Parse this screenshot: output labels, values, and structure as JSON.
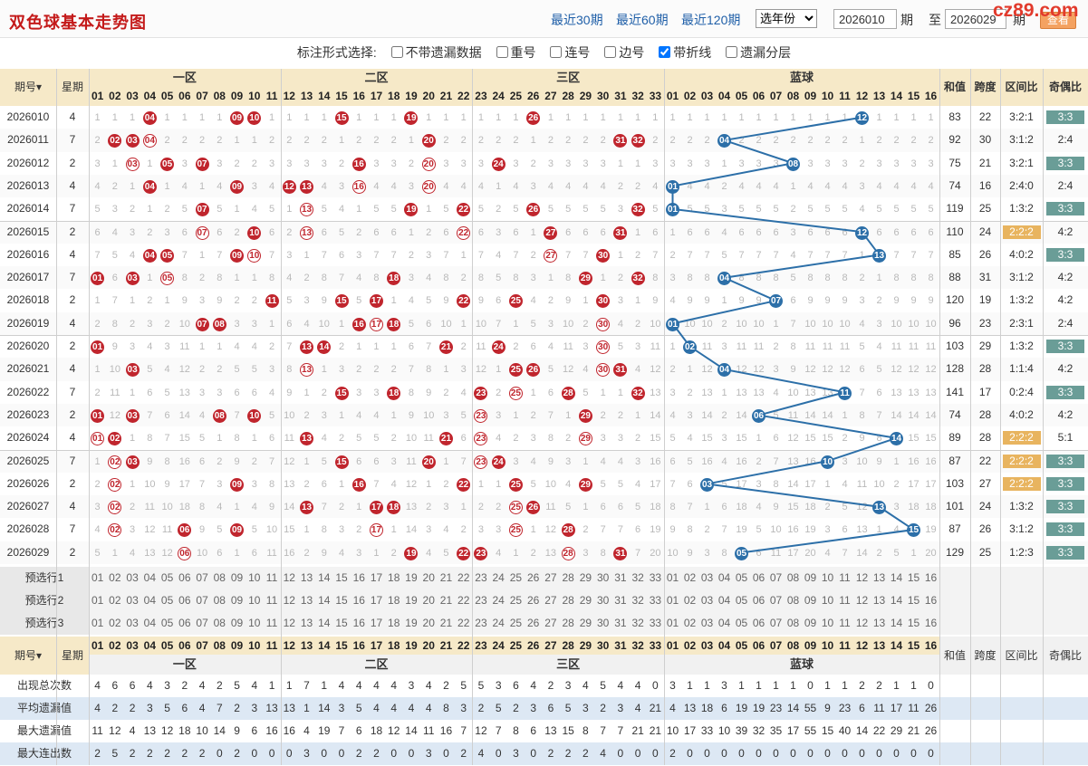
{
  "header": {
    "title": "双色球基本走势图",
    "links": [
      "最近30期",
      "最近60期",
      "最近120期"
    ],
    "year_select": "选年份",
    "from_issue": "2026010",
    "issue_label": "期",
    "to_label": "至",
    "to_issue": "2026029",
    "to_issue_suffix": "期",
    "query_button": "查看",
    "logo": "cz89.com"
  },
  "options": {
    "label": "标注形式选择:",
    "items": [
      {
        "label": "不带遗漏数据",
        "checked": false
      },
      {
        "label": "重号",
        "checked": false
      },
      {
        "label": "连号",
        "checked": false
      },
      {
        "label": "边号",
        "checked": false
      },
      {
        "label": "带折线",
        "checked": true
      },
      {
        "label": "遗漏分层",
        "checked": false
      }
    ]
  },
  "columns": {
    "issue": "期号",
    "weekday": "星期",
    "zones": [
      "一区",
      "二区",
      "三区",
      "蓝球"
    ],
    "sum": "和值",
    "span": "跨度",
    "zone_ratio": "区间比",
    "parity": "奇偶比"
  },
  "red_numbers": [
    "01",
    "02",
    "03",
    "04",
    "05",
    "06",
    "07",
    "08",
    "09",
    "10",
    "11",
    "12",
    "13",
    "14",
    "15",
    "16",
    "17",
    "18",
    "19",
    "20",
    "21",
    "22",
    "23",
    "24",
    "25",
    "26",
    "27",
    "28",
    "29",
    "30",
    "31",
    "32",
    "33"
  ],
  "blue_numbers": [
    "01",
    "02",
    "03",
    "04",
    "05",
    "06",
    "07",
    "08",
    "09",
    "10",
    "11",
    "12",
    "13",
    "14",
    "15",
    "16"
  ],
  "rows": [
    {
      "issue": "2026010",
      "weekday": "4",
      "reds": [
        4,
        9,
        10,
        15,
        19,
        26
      ],
      "blue": 12,
      "sum": "83",
      "span": "22",
      "zone": "3:2:1",
      "parity": "3:3"
    },
    {
      "issue": "2026011",
      "weekday": "7",
      "reds": [
        2,
        3,
        4,
        20,
        31,
        32
      ],
      "blue": 4,
      "sum": "92",
      "span": "30",
      "zone": "3:1:2",
      "parity": "2:4"
    },
    {
      "issue": "2026012",
      "weekday": "2",
      "reds": [
        3,
        5,
        7,
        16,
        20,
        24
      ],
      "blue": 8,
      "sum": "75",
      "span": "21",
      "zone": "3:2:1",
      "parity": "3:3"
    },
    {
      "issue": "2026013",
      "weekday": "4",
      "reds": [
        4,
        9,
        12,
        13,
        16,
        20
      ],
      "blue": 1,
      "sum": "74",
      "span": "16",
      "zone": "2:4:0",
      "parity": "2:4"
    },
    {
      "issue": "2026014",
      "weekday": "7",
      "reds": [
        7,
        13,
        19,
        22,
        26,
        32
      ],
      "blue": 1,
      "sum": "119",
      "span": "25",
      "zone": "1:3:2",
      "parity": "3:3"
    },
    {
      "issue": "2026015",
      "weekday": "2",
      "reds": [
        7,
        10,
        13,
        22,
        27,
        31
      ],
      "blue": 12,
      "sum": "110",
      "span": "24",
      "zone": "2:2:2",
      "parity": "4:2"
    },
    {
      "issue": "2026016",
      "weekday": "4",
      "reds": [
        4,
        5,
        9,
        10,
        27,
        30
      ],
      "blue": 13,
      "sum": "85",
      "span": "26",
      "zone": "4:0:2",
      "parity": "3:3"
    },
    {
      "issue": "2026017",
      "weekday": "7",
      "reds": [
        1,
        3,
        5,
        18,
        29,
        32
      ],
      "blue": 4,
      "sum": "88",
      "span": "31",
      "zone": "3:1:2",
      "parity": "4:2"
    },
    {
      "issue": "2026018",
      "weekday": "2",
      "reds": [
        11,
        15,
        17,
        22,
        25,
        30
      ],
      "blue": 7,
      "sum": "120",
      "span": "19",
      "zone": "1:3:2",
      "parity": "4:2"
    },
    {
      "issue": "2026019",
      "weekday": "4",
      "reds": [
        7,
        8,
        16,
        17,
        18,
        30
      ],
      "blue": 1,
      "sum": "96",
      "span": "23",
      "zone": "2:3:1",
      "parity": "2:4"
    },
    {
      "issue": "2026020",
      "weekday": "2",
      "reds": [
        1,
        13,
        14,
        21,
        24,
        30
      ],
      "blue": 2,
      "sum": "103",
      "span": "29",
      "zone": "1:3:2",
      "parity": "3:3"
    },
    {
      "issue": "2026021",
      "weekday": "4",
      "reds": [
        3,
        13,
        25,
        26,
        30,
        31
      ],
      "blue": 4,
      "sum": "128",
      "span": "28",
      "zone": "1:1:4",
      "parity": "4:2"
    },
    {
      "issue": "2026022",
      "weekday": "7",
      "reds": [
        15,
        18,
        23,
        25,
        28,
        32
      ],
      "blue": 11,
      "sum": "141",
      "span": "17",
      "zone": "0:2:4",
      "parity": "3:3"
    },
    {
      "issue": "2026023",
      "weekday": "2",
      "reds": [
        1,
        3,
        8,
        10,
        23,
        29
      ],
      "blue": 6,
      "sum": "74",
      "span": "28",
      "zone": "4:0:2",
      "parity": "4:2"
    },
    {
      "issue": "2026024",
      "weekday": "4",
      "reds": [
        1,
        2,
        13,
        21,
        23,
        29
      ],
      "blue": 14,
      "sum": "89",
      "span": "28",
      "zone": "2:2:2",
      "parity": "5:1"
    },
    {
      "issue": "2026025",
      "weekday": "7",
      "reds": [
        2,
        3,
        15,
        20,
        23,
        24
      ],
      "blue": 10,
      "sum": "87",
      "span": "22",
      "zone": "2:2:2",
      "parity": "3:3"
    },
    {
      "issue": "2026026",
      "weekday": "2",
      "reds": [
        2,
        9,
        16,
        22,
        25,
        29
      ],
      "blue": 3,
      "sum": "103",
      "span": "27",
      "zone": "2:2:2",
      "parity": "3:3"
    },
    {
      "issue": "2026027",
      "weekday": "4",
      "reds": [
        2,
        13,
        17,
        18,
        25,
        26
      ],
      "blue": 13,
      "sum": "101",
      "span": "24",
      "zone": "1:3:2",
      "parity": "3:3"
    },
    {
      "issue": "2026028",
      "weekday": "7",
      "reds": [
        2,
        6,
        9,
        17,
        25,
        28
      ],
      "blue": 15,
      "sum": "87",
      "span": "26",
      "zone": "3:1:2",
      "parity": "3:3"
    },
    {
      "issue": "2026029",
      "weekday": "2",
      "reds": [
        6,
        19,
        22,
        23,
        28,
        31
      ],
      "blue": 5,
      "sum": "129",
      "span": "25",
      "zone": "1:2:3",
      "parity": "3:3"
    }
  ],
  "preselect": [
    "预选行1",
    "预选行2",
    "预选行3"
  ],
  "stats": [
    {
      "label": "出现总次数",
      "red": [
        "4",
        "6",
        "6",
        "4",
        "3",
        "2",
        "4",
        "2",
        "5",
        "4",
        "1",
        "1",
        "7",
        "1",
        "4",
        "4",
        "4",
        "4",
        "3",
        "4",
        "2",
        "5",
        "5",
        "3",
        "6",
        "4",
        "2",
        "3",
        "4",
        "5",
        "4",
        "4",
        "0"
      ],
      "blue": [
        "3",
        "1",
        "1",
        "3",
        "1",
        "1",
        "1",
        "1",
        "0",
        "1",
        "1",
        "2",
        "2",
        "1",
        "1",
        "0"
      ]
    },
    {
      "label": "平均遗漏值",
      "red": [
        "4",
        "2",
        "2",
        "3",
        "5",
        "6",
        "4",
        "7",
        "2",
        "3",
        "13",
        "13",
        "1",
        "14",
        "3",
        "5",
        "4",
        "4",
        "4",
        "4",
        "8",
        "3",
        "2",
        "5",
        "2",
        "3",
        "6",
        "5",
        "3",
        "2",
        "3",
        "4",
        "21"
      ],
      "blue": [
        "4",
        "13",
        "18",
        "6",
        "19",
        "19",
        "23",
        "14",
        "55",
        "9",
        "23",
        "6",
        "11",
        "17",
        "11",
        "26"
      ]
    },
    {
      "label": "最大遗漏值",
      "red": [
        "11",
        "12",
        "4",
        "13",
        "12",
        "18",
        "10",
        "14",
        "9",
        "6",
        "16",
        "16",
        "4",
        "19",
        "7",
        "6",
        "18",
        "12",
        "14",
        "11",
        "16",
        "7",
        "12",
        "7",
        "8",
        "6",
        "13",
        "15",
        "8",
        "7",
        "7",
        "21",
        "21"
      ],
      "blue": [
        "10",
        "17",
        "33",
        "10",
        "39",
        "32",
        "35",
        "17",
        "55",
        "15",
        "40",
        "14",
        "22",
        "29",
        "21",
        "26"
      ]
    },
    {
      "label": "最大连出数",
      "red": [
        "2",
        "5",
        "2",
        "2",
        "2",
        "2",
        "2",
        "0",
        "2",
        "0",
        "0",
        "0",
        "3",
        "0",
        "0",
        "2",
        "2",
        "0",
        "0",
        "3",
        "0",
        "2",
        "4",
        "0",
        "3",
        "0",
        "2",
        "2",
        "2",
        "4",
        "0",
        "0",
        "0"
      ],
      "blue": [
        "2",
        "0",
        "0",
        "0",
        "0",
        "0",
        "0",
        "0",
        "0",
        "0",
        "0",
        "0",
        "0",
        "0",
        "0",
        "0"
      ]
    }
  ],
  "colors": {
    "red_ball": "#c0252d",
    "blue_ball": "#2c6fa8",
    "parity_bg": "#6a9d97",
    "zone_highlight": "#e8b45f",
    "header_bg": "#f6e9c8"
  }
}
